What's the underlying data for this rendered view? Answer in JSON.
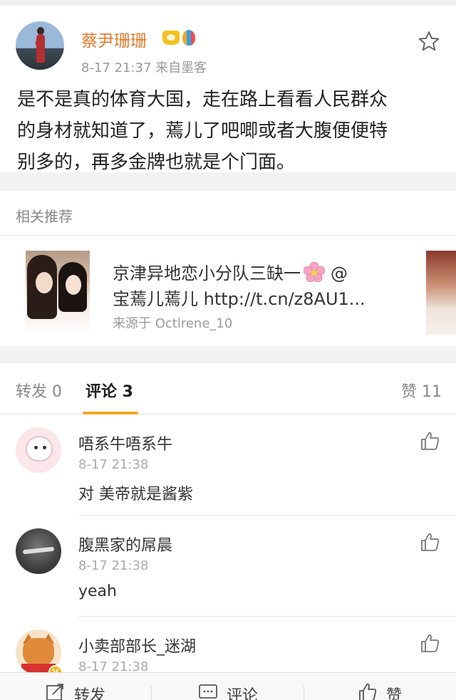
{
  "post": {
    "username": "蔡尹珊珊",
    "meta": "8-17 21:37  来自墨客",
    "text": "是不是真的体育大国，走在路上看看人民群众的身材就知道了，蔫儿了吧唧或者大腹便便特别多的，再多金牌也就是个门面。",
    "line1": "是不是真的体育大国，走在路上看看人民群众",
    "line2": "的身材就知道了，蔫儿了吧唧或者大腹便便特",
    "line3": "别多的，再多金牌也就是个门面。"
  },
  "related": {
    "title": "相关推荐",
    "line1_prefix": "京津异地恋小分队三缺一",
    "line1_suffix": "@",
    "line2": "宝蔫儿蔫儿 http://t.cn/z8AU1...",
    "source": "来源于 Octlrene_10"
  },
  "tabs": {
    "repost": "转发 0",
    "comment": "评论 3",
    "like": "赞 11"
  },
  "comments": [
    {
      "name": "唔系牛唔系牛",
      "time": "8-17 21:38",
      "text": "对 美帝就是酱紫"
    },
    {
      "name": "腹黑家的屌晨",
      "time": "8-17 21:38",
      "text": "yeah"
    },
    {
      "name": "小卖部部长_迷湖",
      "time": "8-17 21:38",
      "text": ""
    }
  ],
  "bottom": {
    "repost": "转发",
    "comment": "评论",
    "like": "赞"
  },
  "colors": {
    "username": "#e07a29",
    "tab_underline": "#f5a623",
    "meta_gray": "#999999"
  },
  "icons": [
    "star-icon",
    "crown-badge-icon",
    "balloon-badge-icon",
    "flower-emoji-icon",
    "thumb-up-icon",
    "repost-icon",
    "comment-icon",
    "like-icon",
    "verified-v-icon"
  ]
}
